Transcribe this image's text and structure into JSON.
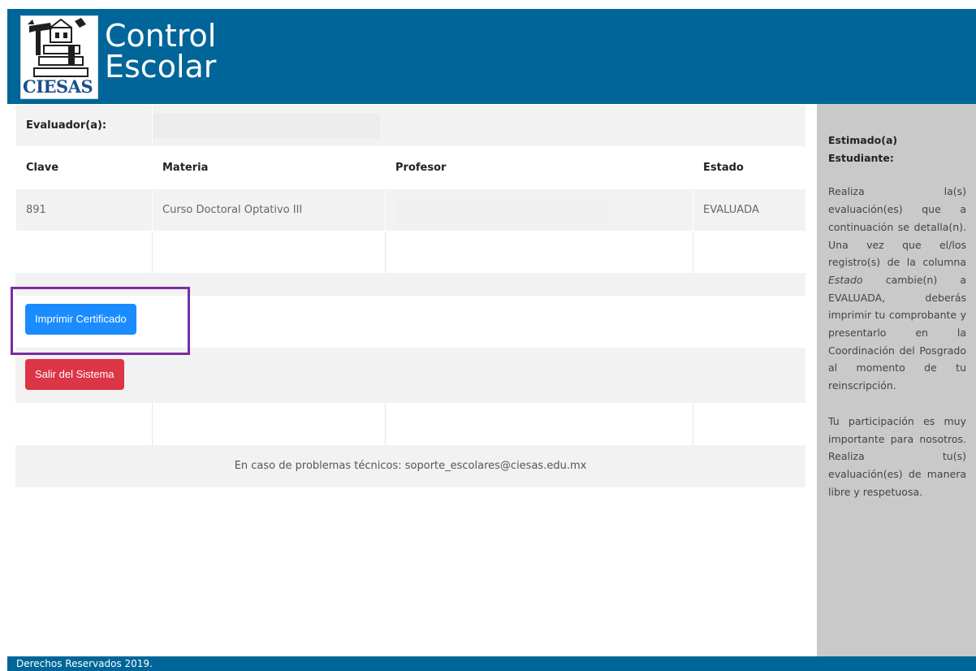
{
  "header": {
    "logo_text": "CIESAS",
    "title_line1": "Control",
    "title_line2": "Escolar"
  },
  "evaluator": {
    "label": "Evaluador(a):"
  },
  "table": {
    "headers": [
      "Clave",
      "Materia",
      "Profesor",
      "Estado"
    ],
    "rows": [
      {
        "clave": "891",
        "materia": "Curso Doctoral Optativo III",
        "estado": "EVALUADA"
      }
    ]
  },
  "buttons": {
    "print": "Imprimir Certificado",
    "logout": "Salir del Sistema"
  },
  "support_message": "En caso de problemas técnicos: soporte_escolares@ciesas.edu.mx",
  "sidebar": {
    "heading_line1": "Estimado(a)",
    "heading_line2": "Estudiante:",
    "paragraph1_a": "Realiza la(s) evaluación(es) que a continuación se detalla(n). Una vez que el/los registro(s) de la columna ",
    "paragraph1_em": "Estado",
    "paragraph1_b": " cambie(n) a EVALUADA, deberás imprimir tu comprobante y presentarlo en la Coordinación del Posgrado al momento de tu reinscripción.",
    "paragraph2": "Tu participación es muy importante para nosotros. Realiza tu(s) evaluación(es) de manera libre y respetuosa."
  },
  "footer": {
    "text": "Derechos Reservados 2019."
  },
  "colors": {
    "brand": "#006699",
    "primary_button": "#1a8cff",
    "danger_button": "#dc3545",
    "highlight": "#7b2d9e"
  }
}
